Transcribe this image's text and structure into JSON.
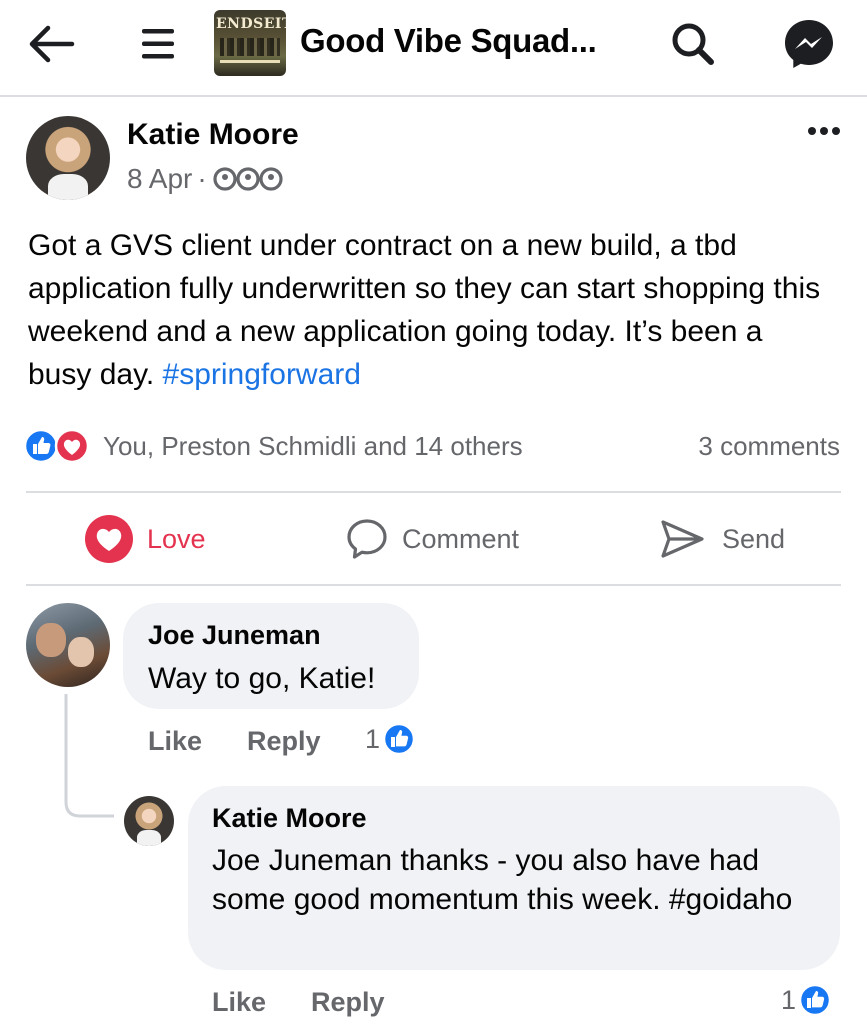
{
  "header": {
    "group_title": "Good Vibe Squad...",
    "group_thumb_text": "ENDSEIT"
  },
  "post": {
    "author": "Katie Moore",
    "date": "8 Apr",
    "separator": "·",
    "privacy_icon": "members-icon",
    "body_text": "Got a GVS client under contract on a new build, a tbd application fully underwritten so they can start shopping this weekend and a new application going today. It’s been a busy day. ",
    "hashtag": "#springforward",
    "reactions_summary": "You, Preston Schmidli and 14 others",
    "comments_count": "3 comments"
  },
  "actions": {
    "love": "Love",
    "comment": "Comment",
    "send": "Send"
  },
  "comments": [
    {
      "author": "Joe Juneman",
      "text": "Way to go, Katie!",
      "like": "Like",
      "reply": "Reply",
      "reaction_count": "1"
    },
    {
      "author": "Katie Moore",
      "text": "Joe Juneman thanks - you also have had some good momentum this week. #goidaho",
      "like": "Like",
      "reply": "Reply",
      "reaction_count": "1"
    }
  ],
  "colors": {
    "accent": "#1877f2",
    "love": "#e4334e",
    "hashtag": "#1b74e4",
    "meta": "#65676b",
    "bubble": "#f0f2f5"
  }
}
